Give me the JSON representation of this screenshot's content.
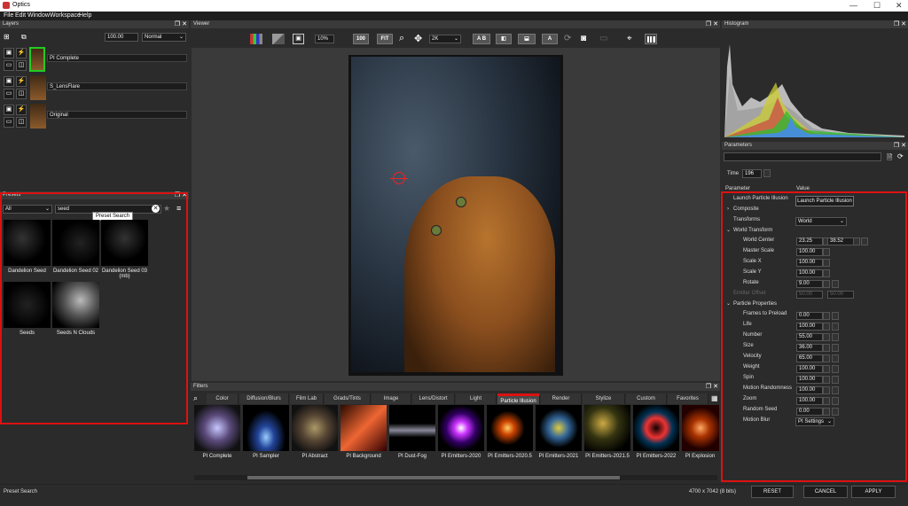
{
  "window": {
    "title": "Optics",
    "minimize": "—",
    "maximize": "☐",
    "close": "✕"
  },
  "menu": [
    "File",
    "Edit",
    "Window",
    "Workspace",
    "Help"
  ],
  "layers": {
    "title": "Layers",
    "opacity": "100.00",
    "blend_mode": "Normal",
    "items": [
      {
        "name": "PI Complete"
      },
      {
        "name": "S_LensFlare"
      },
      {
        "name": "Original"
      }
    ]
  },
  "presets": {
    "title": "Presets",
    "category": "All",
    "search": "seed",
    "tooltip": "Preset Search",
    "items": [
      "Dandelion Seed",
      "Dandelion Seed 02",
      "Dandelion Seed 03 (mb)",
      "Seeds",
      "Seeds N Clouds"
    ]
  },
  "viewer": {
    "title": "Viewer",
    "zoom": "10%",
    "btn_100": "100",
    "btn_fit": "FIT",
    "resolution": "2K",
    "btn_ab": "A B",
    "btn_a": "A"
  },
  "histogram": {
    "title": "Histogram"
  },
  "parameters": {
    "title": "Parameters",
    "time_label": "Time",
    "time_value": "196",
    "col_param": "Parameter",
    "col_value": "Value",
    "rows": [
      {
        "label": "Launch Particle Illusion",
        "button": "Launch Particle Illusion"
      },
      {
        "label": "Composite"
      },
      {
        "label": "Transforms",
        "select": "World"
      },
      {
        "label": "World Transform"
      },
      {
        "label": "World Center",
        "v1": "23.25",
        "v2": "38.52"
      },
      {
        "label": "Master Scale",
        "v1": "100.00"
      },
      {
        "label": "Scale X",
        "v1": "100.00"
      },
      {
        "label": "Scale Y",
        "v1": "100.00"
      },
      {
        "label": "Rotate",
        "v1": "9.00"
      },
      {
        "label": "Emitter Offset",
        "v1": "50.00",
        "v2": "50.00"
      },
      {
        "label": "Particle Properties"
      },
      {
        "label": "Frames to Preload",
        "v1": "0.00"
      },
      {
        "label": "Life",
        "v1": "100.00"
      },
      {
        "label": "Number",
        "v1": "55.00"
      },
      {
        "label": "Size",
        "v1": "36.00"
      },
      {
        "label": "Velocity",
        "v1": "65.00"
      },
      {
        "label": "Weight",
        "v1": "100.00"
      },
      {
        "label": "Spin",
        "v1": "100.00"
      },
      {
        "label": "Motion Randomness",
        "v1": "100.00"
      },
      {
        "label": "Zoom",
        "v1": "100.00"
      },
      {
        "label": "Random Seed",
        "v1": "0.00"
      },
      {
        "label": "Motion Blur",
        "select": "PI Settings"
      }
    ]
  },
  "filters": {
    "title": "Filters",
    "tabs": [
      "Color",
      "Diffusion/Blurs",
      "Film Lab",
      "Grads/Tints",
      "Image",
      "Lens/Distort",
      "Light",
      "Particle Illusion",
      "Render",
      "Stylize",
      "Custom",
      "Favorites"
    ],
    "active_tab": "Particle Illusion",
    "items": [
      "PI Complete",
      "PI Sampler",
      "PI Abstract",
      "PI Background",
      "PI Dust-Fog",
      "PI Emitters-2020",
      "PI Emitters-2020.5",
      "PI Emitters-2021",
      "PI Emitters-2021.5",
      "PI Emitters-2022",
      "PI Explosion"
    ]
  },
  "status": {
    "left": "Preset Search",
    "dimensions": "4700 x 7042 (8 bits)",
    "reset": "RESET",
    "cancel": "CANCEL",
    "apply": "APPLY"
  },
  "colors": {
    "highlight_red": "#d11111",
    "accent_green": "#22cc22"
  }
}
